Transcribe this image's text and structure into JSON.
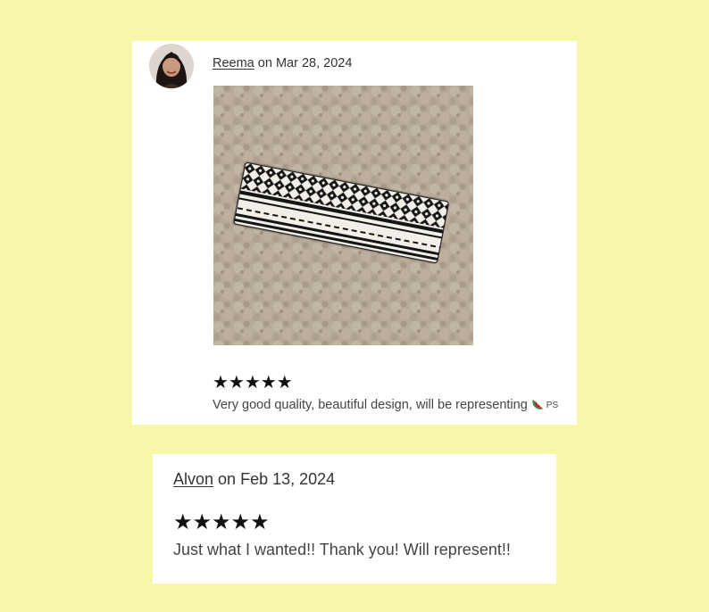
{
  "reviews": [
    {
      "reviewer": "Reema",
      "date_text": "on Mar 28, 2024",
      "stars": "★★★★★",
      "rating": 5,
      "text": "Very good quality, beautiful design, will be representing",
      "emoji": "watermelon-icon",
      "suffix": "PS",
      "has_photo": true
    },
    {
      "reviewer": "Alvon",
      "date_text": "on Feb 13, 2024",
      "stars": "★★★★★",
      "rating": 5,
      "text": "Just what I wanted!! Thank you! Will represent!!",
      "has_photo": false
    }
  ],
  "colors": {
    "background": "#f6f7a8",
    "card": "#ffffff",
    "star": "#111111",
    "text": "#444444"
  }
}
